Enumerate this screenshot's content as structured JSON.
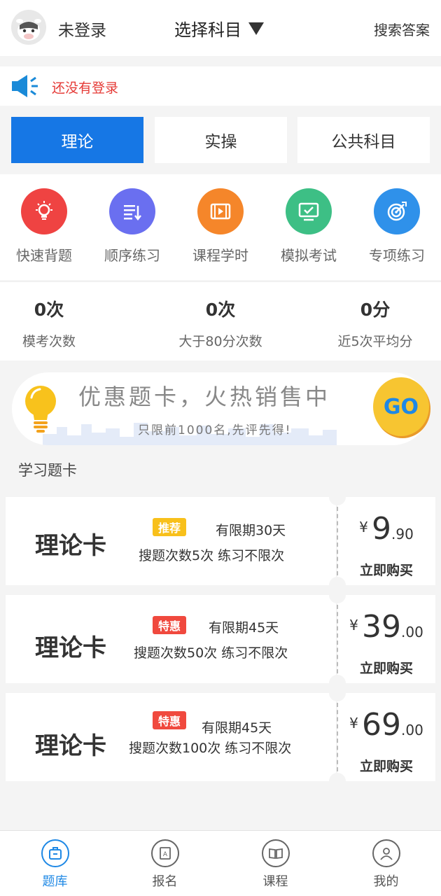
{
  "header": {
    "login_status": "未登录",
    "subject_select_label": "选择科目",
    "search_answer_label": "搜索答案"
  },
  "notice": {
    "message": "还没有登录"
  },
  "tabs": [
    {
      "label": "理论",
      "active": true
    },
    {
      "label": "实操",
      "active": false
    },
    {
      "label": "公共科目",
      "active": false
    }
  ],
  "features": [
    {
      "label": "快速背题",
      "icon": "lightbulb-icon",
      "color": "#ef4342"
    },
    {
      "label": "顺序练习",
      "icon": "list-order-icon",
      "color": "#6a6ff0"
    },
    {
      "label": "课程学时",
      "icon": "video-icon",
      "color": "#f5862a"
    },
    {
      "label": "模拟考试",
      "icon": "monitor-check-icon",
      "color": "#3dbf85"
    },
    {
      "label": "专项练习",
      "icon": "target-icon",
      "color": "#2f91ea"
    }
  ],
  "stats": [
    {
      "value": "0次",
      "label": "模考次数"
    },
    {
      "value": "0次",
      "label": "大于80分次数"
    },
    {
      "value": "0分",
      "label": "近5次平均分"
    }
  ],
  "promo": {
    "title": "优惠题卡，火热销售中",
    "subtitle": "只限前1000名,先评先得!",
    "go_label": "GO"
  },
  "section_title": "学习题卡",
  "cards": [
    {
      "name": "理论卡",
      "badge": "推荐",
      "badge_color": "#f8c01b",
      "validity": "有限期30天",
      "desc": "搜题次数5次  练习不限次",
      "currency": "¥",
      "price_int": "9",
      "price_dec": ".90",
      "buy_label": "立即购买"
    },
    {
      "name": "理论卡",
      "badge": "特惠",
      "badge_color": "#f0493e",
      "validity": "有限期45天",
      "desc": "搜题次数50次  练习不限次",
      "currency": "¥",
      "price_int": "39",
      "price_dec": ".00",
      "buy_label": "立即购买"
    },
    {
      "name": "理论卡",
      "badge": "特惠",
      "badge_color": "#f0493e",
      "validity": "有限期45天",
      "desc": "搜题次数100次  练习不限次",
      "currency": "¥",
      "price_int": "69",
      "price_dec": ".00",
      "buy_label": "立即购买"
    }
  ],
  "bottom_nav": [
    {
      "label": "题库",
      "icon": "question-bank-icon",
      "active": true
    },
    {
      "label": "报名",
      "icon": "register-icon",
      "active": false
    },
    {
      "label": "课程",
      "icon": "course-book-icon",
      "active": false
    },
    {
      "label": "我的",
      "icon": "profile-icon",
      "active": false
    }
  ]
}
